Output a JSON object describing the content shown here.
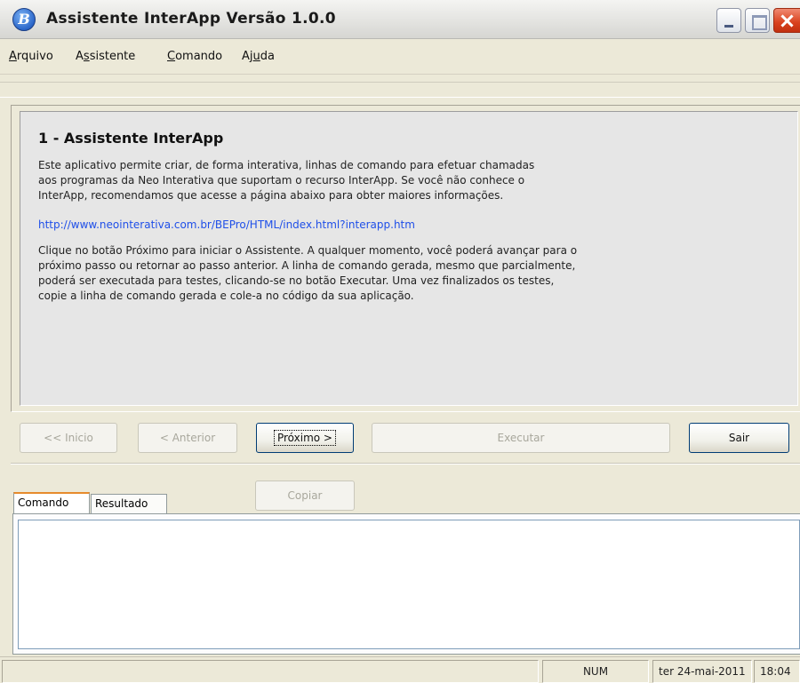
{
  "window": {
    "title": "Assistente InterApp Versão 1.0.0",
    "icon": "app-logo-icon",
    "controls": [
      "minimize-icon",
      "maximize-icon",
      "close-icon"
    ]
  },
  "menu": [
    {
      "label_pre": "",
      "label_u": "A",
      "label_post": "rquivo"
    },
    {
      "label_pre": "A",
      "label_u": "s",
      "label_post": "sistente"
    },
    {
      "label_pre": "",
      "label_u": "C",
      "label_post": "omando"
    },
    {
      "label_pre": "Aj",
      "label_u": "u",
      "label_post": "da"
    }
  ],
  "info": {
    "heading": "1 - Assistente InterApp",
    "paragraph1_lines": [
      "Este aplicativo permite criar, de forma interativa, linhas de comando para efetuar chamadas",
      "aos programas da Neo Interativa que suportam o recurso InterApp. Se você não conhece o",
      "InterApp, recomendamos que acesse a página abaixo para obter maiores informações."
    ],
    "link": "http://www.neointerativa.com.br/BEPro/HTML/index.html?interapp.htm",
    "paragraph2_lines": [
      "Clique no botão Próximo para iniciar o Assistente. A qualquer momento, você poderá avançar para o",
      "próximo passo ou retornar ao passo anterior. A linha de comando gerada, mesmo que parcialmente,",
      "poderá ser executada para testes, clicando-se no botão Executar. Uma vez finalizados os testes,",
      "copie a linha de comando gerada e cole-a no código da sua aplicação."
    ]
  },
  "buttons": {
    "inicio": "<< Inicio",
    "anterior": "< Anterior",
    "proximo": "Próximo >",
    "executar": "Executar",
    "sair": "Sair",
    "copiar": "Copiar"
  },
  "tabs": {
    "comando": "Comando",
    "resultado": "Resultado",
    "selected": "Comando"
  },
  "command_text": "",
  "status": {
    "main": "",
    "num": "NUM",
    "date": "ter 24-mai-2011",
    "time": "18:04"
  }
}
